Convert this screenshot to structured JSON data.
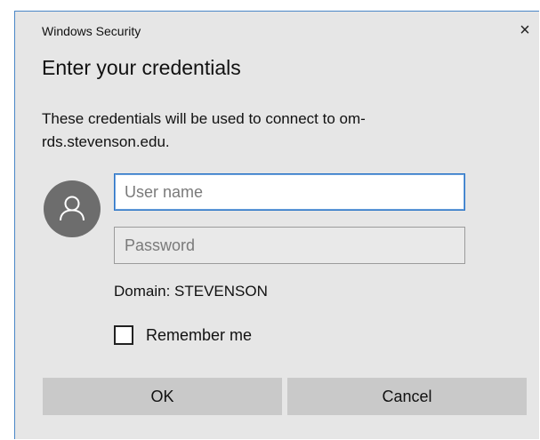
{
  "window": {
    "title": "Windows Security",
    "close_glyph": "×",
    "close_icon": "close-icon"
  },
  "dialog": {
    "heading": "Enter your credentials",
    "description": "These credentials will be used to connect to om-rds.stevenson.edu.",
    "avatar_icon": "user-icon"
  },
  "form": {
    "username": {
      "placeholder": "User name",
      "value": ""
    },
    "password": {
      "placeholder": "Password",
      "value": ""
    },
    "domain": "Domain: STEVENSON",
    "remember_label": "Remember me",
    "remember_checked": false
  },
  "buttons": {
    "ok_label": "OK",
    "cancel_label": "Cancel"
  },
  "colors": {
    "dialog_background": "#e6e6e6",
    "focus_border": "#2a74c7",
    "button_background": "#c9c9c9",
    "avatar_background": "#6d6d6d"
  }
}
